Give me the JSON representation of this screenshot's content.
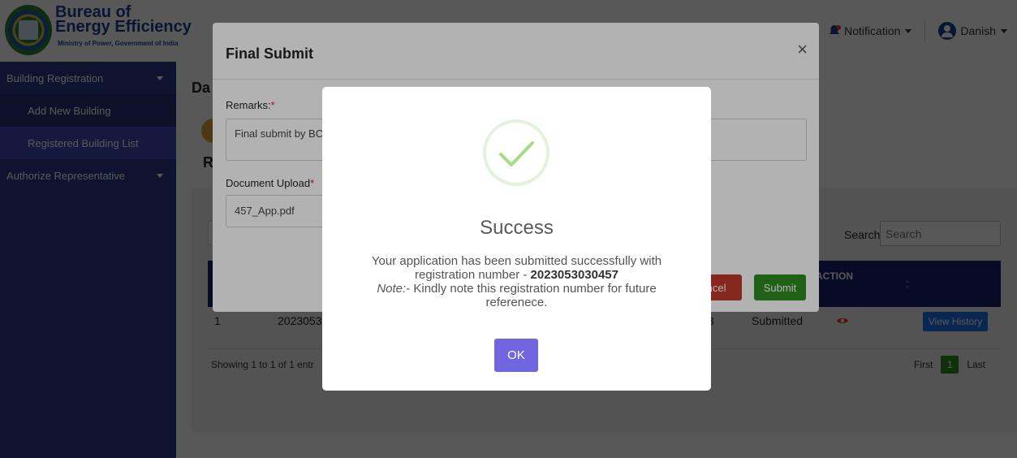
{
  "header": {
    "logo_line1": "Bureau of",
    "logo_line2": "Energy Efficiency",
    "logo_sub": "Ministry of Power, Government of India",
    "notification_label": "Notification",
    "user_name": "Danish"
  },
  "sidebar": {
    "items": [
      {
        "label": "Building Registration"
      },
      {
        "label": "Add New Building"
      },
      {
        "label": "Registered Building List"
      },
      {
        "label": "Authorize Representative"
      }
    ]
  },
  "main": {
    "title_partial": "Da",
    "section_partial": "R",
    "search_label": "Search:",
    "search_placeholder": "Search",
    "table_action_header": "ACTION",
    "row": {
      "sr": "1",
      "reg_partial": "20230530",
      "num_partial": "3",
      "status": "Submitted",
      "history_button": "View History"
    },
    "showing_partial": "Showing 1 to 1 of 1 entr",
    "pager": {
      "first": "First",
      "page": "1",
      "last": "Last"
    }
  },
  "final_submit_modal": {
    "title": "Final Submit",
    "close": "×",
    "remarks_label": "Remarks:",
    "remarks_value": "Final submit by BC",
    "document_label": "Document Upload",
    "document_value": "457_App.pdf",
    "cancel_partial": "ancel",
    "submit": "Submit",
    "required_mark": "*"
  },
  "success_dialog": {
    "title": "Success",
    "text_line1": "Your application has been submitted successfully with registration number - ",
    "registration_number": "2023053030457",
    "note_label": "Note:",
    "note_text": "- Kindly note this registration number for future referenece.",
    "ok_button": "OK"
  },
  "colors": {
    "sidebar": "#2b3a8c",
    "table_header": "#16206e",
    "ok_button": "#7066e0",
    "submit_button": "#2e8b22",
    "success_check": "#a5dc86"
  }
}
